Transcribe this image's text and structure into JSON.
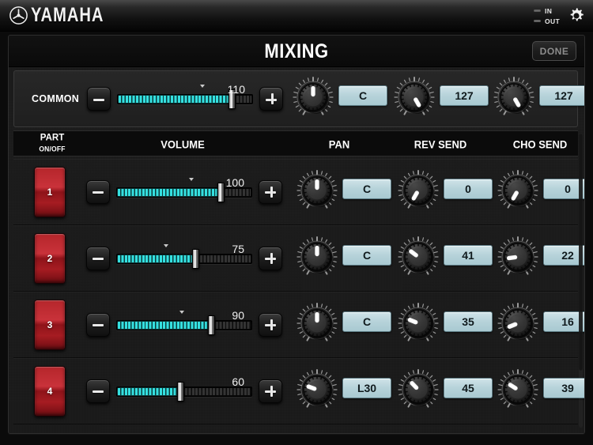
{
  "topbar": {
    "brand": "YAMAHA",
    "logo_icon": "yamaha-tuning-fork-icon",
    "midi_in_label": "IN",
    "midi_out_label": "OUT",
    "settings_icon": "gear-icon"
  },
  "panel": {
    "title": "MIXING",
    "done_label": "DONE"
  },
  "headers": {
    "part": "PART",
    "part_sub": "ON/OFF",
    "volume": "VOLUME",
    "pan": "PAN",
    "rev_send": "REV SEND",
    "cho_send": "CHO SEND"
  },
  "common": {
    "label": "COMMON",
    "volume": 110,
    "volume_max": 127,
    "minus_label": "minus",
    "plus_label": "plus",
    "pan": "C",
    "pan_angle": 0,
    "rev_send": "127",
    "rev_angle": 150,
    "cho_send": "127",
    "cho_angle": 150
  },
  "parts": [
    {
      "number": "1",
      "on": true,
      "volume": 100,
      "pan": "C",
      "pan_angle": 0,
      "rev_send": "0",
      "rev_angle": -150,
      "cho_send": "0",
      "cho_angle": -150
    },
    {
      "number": "2",
      "on": true,
      "volume": 75,
      "pan": "C",
      "pan_angle": 0,
      "rev_send": "41",
      "rev_angle": -53,
      "cho_send": "22",
      "cho_angle": -98
    },
    {
      "number": "3",
      "on": true,
      "volume": 90,
      "pan": "C",
      "pan_angle": 0,
      "rev_send": "35",
      "rev_angle": -68,
      "cho_send": "16",
      "cho_angle": -112
    },
    {
      "number": "4",
      "on": true,
      "volume": 60,
      "pan": "L30",
      "pan_angle": -70,
      "rev_send": "45",
      "rev_angle": -44,
      "cho_send": "39",
      "cho_angle": -58
    }
  ],
  "colors": {
    "led_on": "#35e0e0",
    "readout_bg": "#b7d3da",
    "part_on": "#c9323a",
    "panel_bg": "#1b1b1b",
    "accent_text": "#ffffff"
  }
}
